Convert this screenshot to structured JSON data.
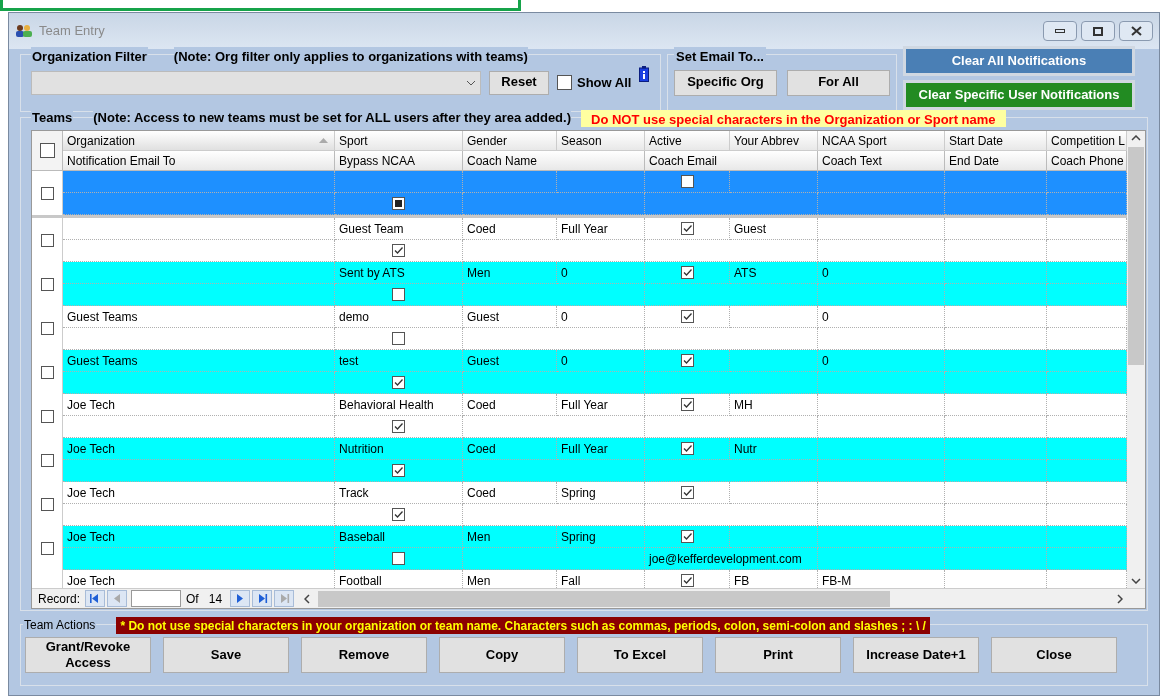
{
  "window": {
    "title": "Team Entry"
  },
  "org_filter": {
    "label": "Organization Filter",
    "note": "(Note:  Org filter only applies to organizations with teams)",
    "reset": "Reset",
    "show_all": {
      "label": "Show All",
      "checked": false
    }
  },
  "set_email": {
    "label": "Set Email To...",
    "buttons": [
      "Specific Org",
      "For All"
    ]
  },
  "notification_buttons": [
    {
      "label": "Clear All Notifications",
      "color": "#4a7fb5"
    },
    {
      "label": "Clear Specific User Notifications",
      "color": "#228b22"
    }
  ],
  "teams": {
    "label": "Teams",
    "note": "(Note:  Access to new teams must be set for ALL users after they area added.)",
    "warning": "Do NOT use special characters in the Organization or Sport name",
    "select_all": {
      "checked": false
    },
    "columns_top": [
      {
        "label": "Organization",
        "sorted": true
      },
      {
        "label": "Sport",
        "sorted": false
      },
      {
        "label": "Gender",
        "sorted": false
      },
      {
        "label": "Season",
        "sorted": false
      },
      {
        "label": "Active",
        "sorted": false
      },
      {
        "label": "Your Abbrev",
        "sorted": false
      },
      {
        "label": "NCAA Sport",
        "sorted": false
      },
      {
        "label": "Start Date",
        "sorted": false
      },
      {
        "label": "Competition L",
        "sorted": false
      }
    ],
    "columns_bottom": [
      "Notification Email To",
      "Bypass NCAA",
      "Coach Name",
      "Coach Email",
      "Coach Text",
      "End Date",
      "Coach Phone"
    ],
    "rows": [
      {
        "selected": true,
        "checked": false,
        "active": false,
        "bypass_ncaa": {
          "checked": false,
          "indeterminate": true
        }
      },
      {
        "selected": false,
        "checked": false,
        "sport": "Guest Team",
        "gender": "Coed",
        "season": "Full Year",
        "active": true,
        "abbrev": "Guest",
        "bypass_ncaa": {
          "checked": true,
          "indeterminate": false
        }
      },
      {
        "selected": false,
        "checked": false,
        "sport": "Sent by ATS",
        "gender": "Men",
        "season": "0",
        "active": true,
        "abbrev": "ATS",
        "ncaa_sport": "0",
        "bypass_ncaa": {
          "checked": false,
          "indeterminate": false
        }
      },
      {
        "selected": false,
        "checked": false,
        "organization": "Guest Teams",
        "sport": "demo",
        "gender": "Guest",
        "season": "0",
        "active": true,
        "ncaa_sport": "0",
        "bypass_ncaa": {
          "checked": false,
          "indeterminate": false
        }
      },
      {
        "selected": false,
        "checked": false,
        "organization": "Guest Teams",
        "sport": "test",
        "gender": "Guest",
        "season": "0",
        "active": true,
        "ncaa_sport": "0",
        "bypass_ncaa": {
          "checked": true,
          "indeterminate": false
        }
      },
      {
        "selected": false,
        "checked": false,
        "organization": "Joe Tech",
        "sport": "Behavioral Health",
        "gender": "Coed",
        "season": "Full Year",
        "active": true,
        "abbrev": "MH",
        "bypass_ncaa": {
          "checked": true,
          "indeterminate": false
        }
      },
      {
        "selected": false,
        "checked": false,
        "organization": "Joe Tech",
        "sport": "Nutrition",
        "gender": "Coed",
        "season": "Full Year",
        "active": true,
        "abbrev": "Nutr",
        "bypass_ncaa": {
          "checked": true,
          "indeterminate": false
        }
      },
      {
        "selected": false,
        "checked": false,
        "organization": "Joe Tech",
        "sport": "Track",
        "gender": "Coed",
        "season": "Spring",
        "active": true,
        "bypass_ncaa": {
          "checked": true,
          "indeterminate": false
        }
      },
      {
        "selected": false,
        "checked": false,
        "organization": "Joe Tech",
        "sport": "Baseball",
        "gender": "Men",
        "season": "Spring",
        "active": true,
        "coach_email": "joe@kefferdevelopment.com",
        "bypass_ncaa": {
          "checked": false,
          "indeterminate": false
        }
      },
      {
        "selected": false,
        "organization": "Joe Tech",
        "sport": "Football",
        "gender": "Men",
        "season": "Fall",
        "active": true,
        "abbrev": "FB",
        "ncaa_sport": "FB-M"
      }
    ]
  },
  "navigator": {
    "label": "Record:",
    "of": "Of",
    "total": "14"
  },
  "team_actions": {
    "label": "Team Actions",
    "warning": "* Do not use special characters in your organization or team name.  Characters such as commas, periods, colon, semi-colon and slashes  ;  :  \\  /",
    "buttons": [
      "Grant/Revoke Access",
      "Save",
      "Remove",
      "Copy",
      "To Excel",
      "Print",
      "Increase Date+1",
      "Close"
    ]
  }
}
